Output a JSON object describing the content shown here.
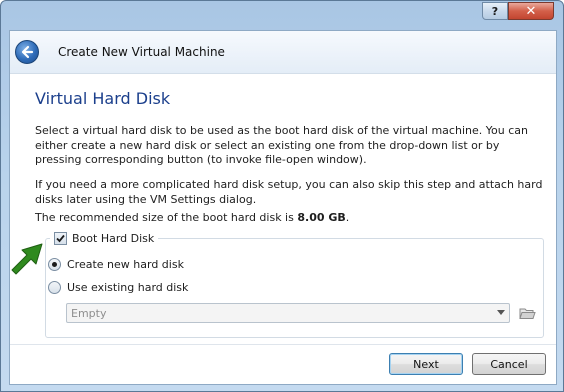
{
  "window": {
    "help_label": "?",
    "close_label": "✕",
    "title": "Create New Virtual Machine"
  },
  "page": {
    "title": "Virtual Hard Disk",
    "paragraph1": "Select a virtual hard disk to be used as the boot hard disk of the virtual machine. You can either create a new hard disk or select an existing one from the drop-down list or by pressing corresponding button (to invoke file-open window).",
    "paragraph2": "If you need a more complicated hard disk setup, you can also skip this step and attach hard disks later using the VM Settings dialog.",
    "recommend_prefix": "The recommended size of the boot hard disk is ",
    "recommend_size": "8.00 GB",
    "recommend_suffix": "."
  },
  "boot_disk": {
    "label": "Boot Hard Disk",
    "checked": true,
    "options": [
      {
        "label": "Create new hard disk",
        "selected": true
      },
      {
        "label": "Use existing hard disk",
        "selected": false
      }
    ],
    "existing_select_value": "Empty"
  },
  "buttons": {
    "next": "Next",
    "cancel": "Cancel"
  },
  "icons": {
    "back": "back-arrow-icon",
    "folder": "folder-open-icon",
    "annotation": "green-arrow-icon"
  },
  "colors": {
    "title_text": "#1b3f8c",
    "chrome": "#b9d3ec",
    "close": "#c24530",
    "annotation_arrow": "#2f8a1e"
  }
}
